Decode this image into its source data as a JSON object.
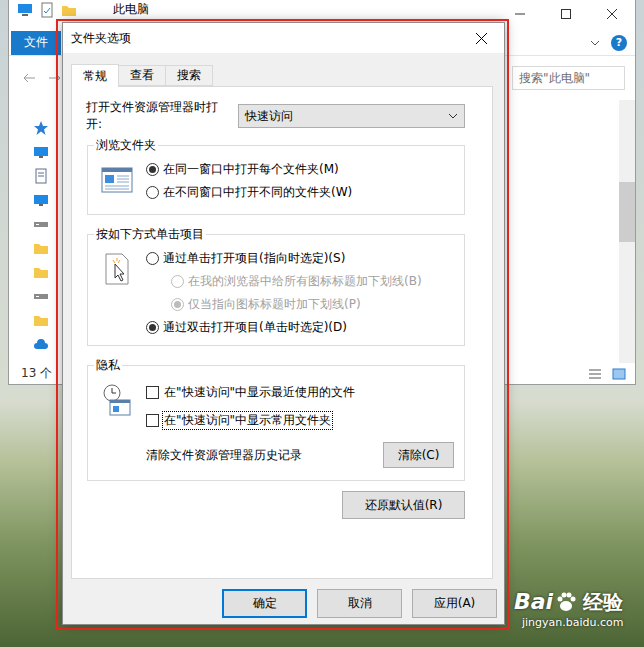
{
  "explorer": {
    "title": "此电脑",
    "file_tab": "文件",
    "help": "?",
    "search_placeholder": "搜索\"此电脑\"",
    "status": "13 个"
  },
  "dialog": {
    "title": "文件夹选项"
  },
  "tabs": [
    {
      "label": "常规",
      "selected": true
    },
    {
      "label": "查看",
      "selected": false
    },
    {
      "label": "搜索",
      "selected": false
    }
  ],
  "open_in": {
    "label": "打开文件资源管理器时打开:",
    "value": "快速访问"
  },
  "browse": {
    "title": "浏览文件夹",
    "options": [
      {
        "label": "在同一窗口中打开每个文件夹(M)",
        "selected": true,
        "disabled": false,
        "kind": "main"
      },
      {
        "label": "在不同窗口中打开不同的文件夹(W)",
        "selected": false,
        "disabled": false,
        "kind": "main"
      }
    ]
  },
  "click": {
    "title": "按如下方式单击项目",
    "options": [
      {
        "label": "通过单击打开项目(指向时选定)(S)",
        "selected": false,
        "disabled": false,
        "kind": "main"
      },
      {
        "label": "在我的浏览器中给所有图标标题加下划线(B)",
        "selected": false,
        "disabled": true,
        "kind": "sub"
      },
      {
        "label": "仅当指向图标标题时加下划线(P)",
        "selected": true,
        "disabled": true,
        "kind": "sub"
      },
      {
        "label": "通过双击打开项目(单击时选定)(D)",
        "selected": true,
        "disabled": false,
        "kind": "main"
      }
    ]
  },
  "privacy": {
    "title": "隐私",
    "checks": [
      {
        "label": "在\"快速访问\"中显示最近使用的文件",
        "checked": false,
        "focused": false
      },
      {
        "label": "在\"快速访问\"中显示常用文件夹",
        "checked": false,
        "focused": true
      }
    ],
    "clear_label": "清除文件资源管理器历史记录",
    "clear_button": "清除(C)"
  },
  "restore_button": "还原默认值(R)",
  "buttons": [
    {
      "label": "确定",
      "default": true
    },
    {
      "label": "取消",
      "default": false
    },
    {
      "label": "应用(A)",
      "default": false
    }
  ],
  "watermark": {
    "brand_left": "Bai",
    "brand_right": "经验",
    "url": "jingyan.baidu.com"
  }
}
